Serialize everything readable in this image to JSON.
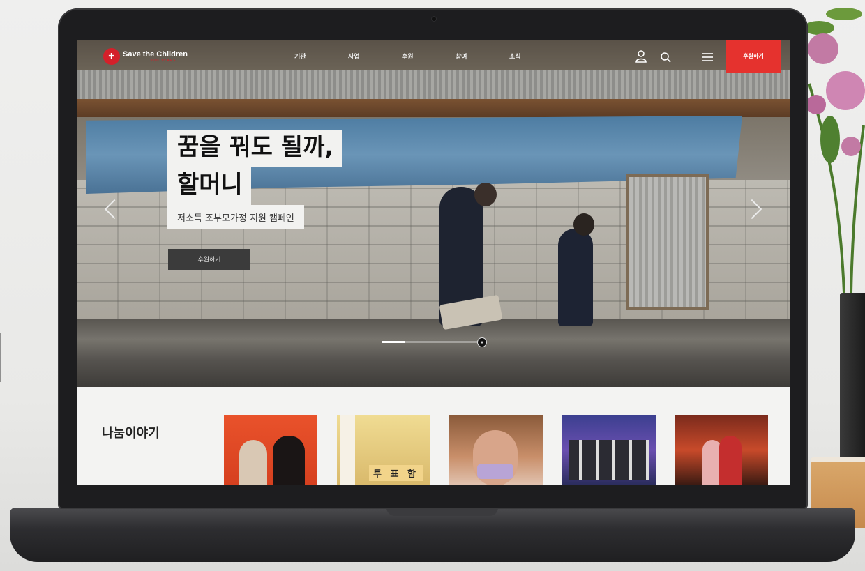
{
  "header": {
    "logo_name": "Save the Children",
    "logo_tag": "100 YEARS",
    "nav": [
      "기관",
      "사업",
      "후원",
      "참여",
      "소식"
    ],
    "donate_label": "후원하기"
  },
  "hero": {
    "title_line1": "꿈을 꿔도 될까,",
    "title_line2": "할머니",
    "subtitle": "저소득 조부모가정 지원 캠페인",
    "cta_label": "후원하기",
    "pause_glyph": "⏸"
  },
  "stories": {
    "title": "나눔이야기",
    "items": [
      {
        "caption": ""
      },
      {
        "caption": "투 표 함"
      },
      {
        "caption": ""
      },
      {
        "caption": ""
      },
      {
        "caption": ""
      }
    ]
  },
  "colors": {
    "brand_red": "#e5322e",
    "logo_red": "#d4202a"
  },
  "icons": [
    "user-icon",
    "search-icon",
    "menu-icon",
    "chevron-left-icon",
    "chevron-right-icon",
    "pause-icon"
  ]
}
